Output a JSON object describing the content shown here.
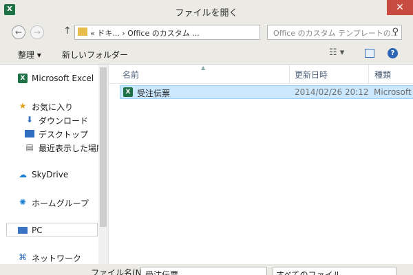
{
  "window": {
    "title": "ファイルを開く",
    "app_icon_letter": "X",
    "close_glyph": "✕"
  },
  "nav": {
    "back_glyph": "←",
    "forward_glyph": "→",
    "up_glyph": "↑",
    "breadcrumb": "« ドキ... › Office のカスタム ...",
    "refresh_glyph": "↻",
    "search_placeholder": "Office のカスタム テンプレートの...",
    "search_glyph": "⚲"
  },
  "toolbar": {
    "organize_label": "整理 ▾",
    "new_folder_label": "新しいフォルダー",
    "view_glyph": "☷ ▾",
    "help_glyph": "?"
  },
  "sidebar": {
    "excel": "Microsoft Excel",
    "favorites": "お気に入り",
    "downloads": "ダウンロード",
    "desktop": "デスクトップ",
    "recent": "最近表示した場所",
    "skydrive": "SkyDrive",
    "homegroup": "ホームグループ",
    "pc": "PC",
    "network": "ネットワーク"
  },
  "columns": {
    "name": "名前",
    "modified": "更新日時",
    "type": "種類"
  },
  "files": [
    {
      "name": "受注伝票",
      "modified": "2014/02/26 20:12",
      "type": "Microsoft"
    }
  ],
  "bottom": {
    "filename_label": "ファイル名(N):",
    "filename_value": "受注伝票",
    "filter_value": "すべてのファイル"
  }
}
